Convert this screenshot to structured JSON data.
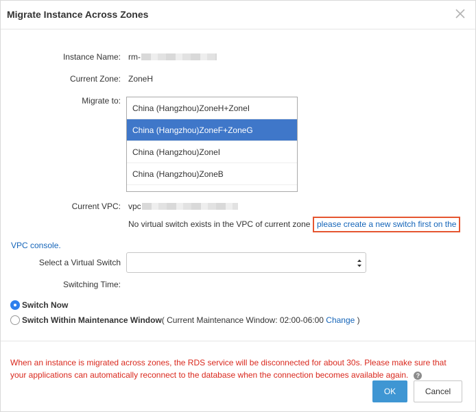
{
  "dialog": {
    "title": "Migrate Instance Across Zones"
  },
  "form": {
    "instance_name_label": "Instance Name:",
    "instance_name_prefix": "rm-",
    "current_zone_label": "Current Zone:",
    "current_zone_value": "ZoneH",
    "migrate_to_label": "Migrate to:",
    "zone_options": [
      "China (Hangzhou)ZoneH+ZoneI",
      "China (Hangzhou)ZoneF+ZoneG",
      "China (Hangzhou)ZoneI",
      "China (Hangzhou)ZoneB"
    ],
    "selected_zone_index": 1,
    "current_vpc_label": "Current VPC:",
    "current_vpc_prefix": "vpc",
    "no_switch_text": "No virtual switch exists in the VPC of current zone",
    "create_switch_link_part1": "please create a new switch first on the",
    "create_switch_link_part2": "VPC console.",
    "virtual_switch_label": "Select a Virtual Switch",
    "virtual_switch_value": "",
    "switching_time_label": "Switching Time:",
    "switch_now_label": "Switch Now",
    "switch_window_label": "Switch Within Maintenance Window",
    "maintenance_window_text": "( Current Maintenance Window: 02:00-06:00",
    "change_link": "Change",
    "close_paren": ")"
  },
  "footer": {
    "warning": "When an instance is migrated across zones, the RDS service will be disconnected for about 30s. Please make sure that your applications can automatically reconnect to the database when the connection becomes available again.",
    "help_glyph": "?",
    "ok_label": "OK",
    "cancel_label": "Cancel"
  },
  "colors": {
    "accent": "#3f96d3",
    "selected_option": "#3f77c9",
    "link": "#1565b9",
    "warning": "#d9281d",
    "highlight_box": "#e5552f"
  }
}
